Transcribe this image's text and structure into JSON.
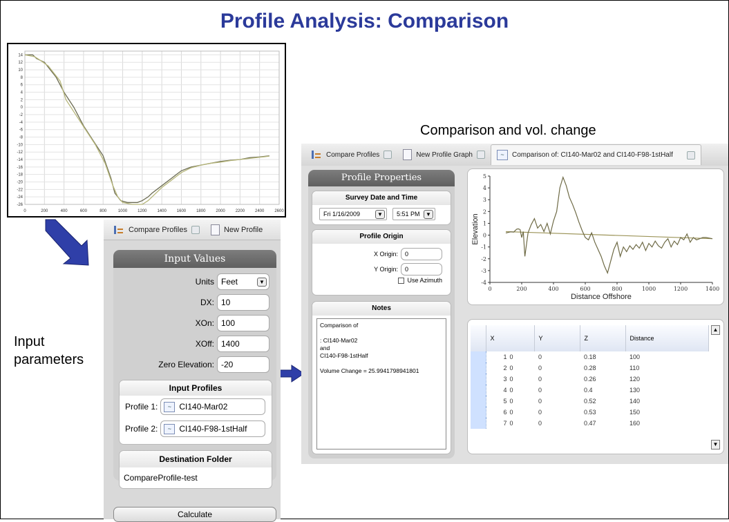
{
  "title": "Profile Analysis: Comparison",
  "captions": {
    "comparison": "Comparison and vol. change",
    "input_line1": "Input",
    "input_line2": "parameters"
  },
  "overview_chart": {
    "x_ticks": [
      "0",
      "200",
      "400",
      "600",
      "800",
      "1000",
      "1200",
      "1400",
      "1600",
      "1800",
      "2000",
      "2200",
      "2400",
      "2600"
    ],
    "y_ticks": [
      "14",
      "12",
      "10",
      "8",
      "6",
      "4",
      "2",
      "0",
      "-2",
      "-4",
      "-6",
      "-8",
      "-10",
      "-12",
      "-14",
      "-16",
      "-18",
      "-20",
      "-22",
      "-24",
      "-26"
    ]
  },
  "input_window": {
    "tabs": [
      "Compare Profiles",
      "New Profile"
    ],
    "panel_title": "Input Values",
    "units_label": "Units",
    "units_value": "Feet",
    "dx_label": "DX:",
    "dx_value": "10",
    "xon_label": "XOn:",
    "xon_value": "100",
    "xoff_label": "XOff:",
    "xoff_value": "1400",
    "zero_label": "Zero Elevation:",
    "zero_value": "-20",
    "profiles_title": "Input Profiles",
    "profile1_label": "Profile 1:",
    "profile1_value": "CI140-Mar02",
    "profile2_label": "Profile 2:",
    "profile2_value": "CI140-F98-1stHalf",
    "dest_title": "Destination Folder",
    "dest_value": "CompareProfile-test",
    "calculate_label": "Calculate"
  },
  "comparison_window": {
    "tabs": [
      "Compare Profiles",
      "New Profile Graph",
      "Comparison of: CI140-Mar02 and CI140-F98-1stHalf"
    ],
    "panel_title": "Profile Properties",
    "survey_title": "Survey Date and Time",
    "date_value": "Fri  1/16/2009",
    "time_value": "5:51 PM",
    "origin_title": "Profile Origin",
    "x_origin_label": "X Origin:",
    "x_origin_value": "0",
    "y_origin_label": "Y Origin:",
    "y_origin_value": "0",
    "use_azimuth_label": "Use Azimuth",
    "notes_title": "Notes",
    "notes_lines": [
      "Comparison of",
      "",
      ": CI140-Mar02",
      "and",
      "CI140-F98-1stHalf",
      "",
      "Volume Change = 25.9941798941801"
    ]
  },
  "table": {
    "columns": [
      "X",
      "Y",
      "Z",
      "Distance"
    ],
    "rows": [
      [
        "1",
        "0",
        "0",
        "0.18",
        "100"
      ],
      [
        "2",
        "0",
        "0",
        "0.28",
        "110"
      ],
      [
        "3",
        "0",
        "0",
        "0.26",
        "120"
      ],
      [
        "4",
        "0",
        "0",
        "0.4",
        "130"
      ],
      [
        "5",
        "0",
        "0",
        "0.52",
        "140"
      ],
      [
        "6",
        "0",
        "0",
        "0.53",
        "150"
      ],
      [
        "7",
        "0",
        "0",
        "0.47",
        "160"
      ]
    ]
  },
  "chart_data": [
    {
      "type": "line",
      "title": "",
      "xlabel": "",
      "ylabel": "",
      "xlim": [
        0,
        2600
      ],
      "ylim": [
        -26,
        15
      ],
      "grid": true,
      "series": [
        {
          "x": [
            0,
            80,
            120,
            200,
            260,
            320,
            400,
            500,
            600,
            700,
            800,
            880,
            920,
            980,
            1050,
            1150,
            1200,
            1260,
            1300,
            1400,
            1500,
            1600,
            1700,
            1800,
            1900,
            2000,
            2100,
            2200,
            2300,
            2400,
            2500
          ],
          "values": [
            14,
            14,
            13,
            12,
            10,
            8,
            4,
            0,
            -5,
            -9,
            -13,
            -19,
            -23,
            -25,
            -25.5,
            -25.5,
            -25,
            -24,
            -23,
            -21,
            -19,
            -17,
            -16,
            -15.5,
            -15,
            -14.5,
            -14.2,
            -14,
            -13.5,
            -13.3,
            -13
          ]
        },
        {
          "x": [
            0,
            100,
            160,
            240,
            300,
            360,
            420,
            520,
            620,
            720,
            820,
            900,
            950,
            1000,
            1100,
            1200,
            1260,
            1320,
            1400,
            1500,
            1600,
            1700,
            1800,
            1900,
            2000,
            2100,
            2200,
            2300,
            2400,
            2500
          ],
          "values": [
            14,
            13.5,
            12.5,
            11,
            9,
            7,
            2,
            -2,
            -6,
            -10,
            -15,
            -21,
            -24,
            -25.5,
            -26,
            -26,
            -25,
            -23.5,
            -21.5,
            -19.5,
            -17.5,
            -16.2,
            -15.5,
            -15,
            -14.7,
            -14.3,
            -14,
            -13.7,
            -13.4,
            -13.1
          ]
        }
      ]
    },
    {
      "type": "line",
      "title": "",
      "xlabel": "Distance Offshore",
      "ylabel": "Elevation",
      "xlim": [
        0,
        1400
      ],
      "ylim": [
        -4,
        5
      ],
      "x_ticks": [
        0,
        200,
        400,
        600,
        800,
        1000,
        1200,
        1400
      ],
      "y_ticks": [
        -4,
        -3,
        -2,
        -1,
        0,
        1,
        2,
        3,
        4,
        5
      ],
      "grid": false,
      "series": [
        {
          "x": [
            100,
            1400
          ],
          "values": [
            0.3,
            -0.3
          ]
        },
        {
          "x": [
            100,
            130,
            150,
            160,
            170,
            180,
            190,
            200,
            210,
            220,
            240,
            260,
            280,
            300,
            320,
            340,
            360,
            380,
            400,
            420,
            440,
            460,
            480,
            500,
            520,
            540,
            560,
            580,
            600,
            620,
            640,
            660,
            680,
            700,
            720,
            740,
            760,
            780,
            800,
            820,
            840,
            860,
            880,
            900,
            920,
            940,
            960,
            980,
            1000,
            1020,
            1040,
            1060,
            1080,
            1100,
            1120,
            1140,
            1160,
            1180,
            1200,
            1220,
            1240,
            1260,
            1280,
            1300,
            1320,
            1340,
            1360,
            1380,
            1400
          ],
          "values": [
            0.18,
            0.28,
            0.26,
            0.4,
            0.52,
            0.53,
            0.47,
            -0.2,
            0.3,
            -1.8,
            0.2,
            0.9,
            1.4,
            0.6,
            0.9,
            0.3,
            1.0,
            0.1,
            1.2,
            2.0,
            4.0,
            4.9,
            4.2,
            3.2,
            2.6,
            1.9,
            1.1,
            0.4,
            -0.2,
            -0.4,
            0.2,
            -0.6,
            -1.2,
            -1.8,
            -2.6,
            -3.2,
            -2.2,
            -1.2,
            -0.6,
            -1.8,
            -1.0,
            -1.4,
            -0.9,
            -1.2,
            -0.8,
            -1.1,
            -0.6,
            -1.3,
            -0.7,
            -1.0,
            -0.5,
            -0.9,
            -1.1,
            -0.6,
            -0.3,
            -1.0,
            -0.5,
            -0.8,
            -0.2,
            -0.4,
            0.1,
            -0.6,
            -0.2,
            -0.4,
            -0.3,
            -0.2,
            -0.2,
            -0.25,
            -0.3
          ]
        }
      ]
    }
  ]
}
